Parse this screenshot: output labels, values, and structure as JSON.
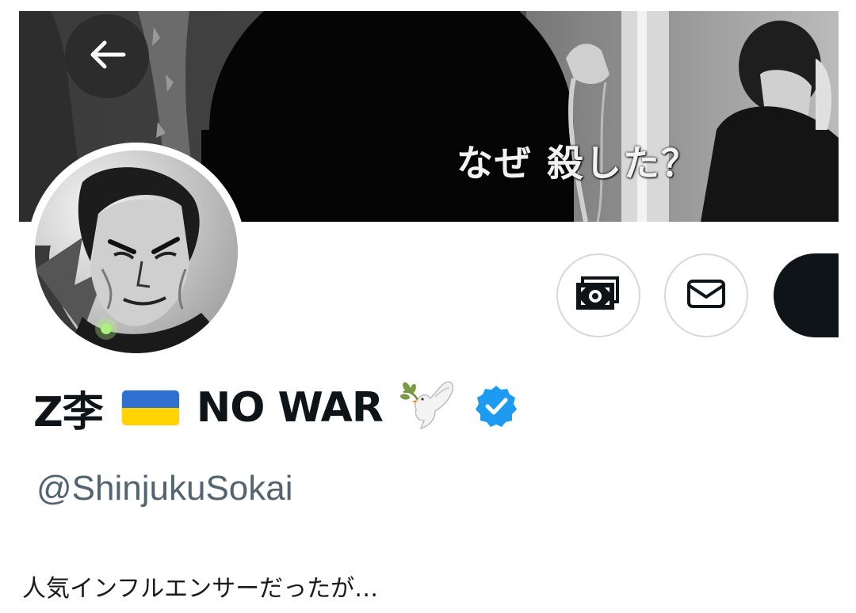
{
  "banner": {
    "caption": "なぜ 殺した？"
  },
  "header": {
    "back_icon": "arrow-left-icon"
  },
  "profile": {
    "display_name_prefix": "Z李",
    "flag": {
      "name": "ukraine-flag",
      "top_color": "#2f6fd0",
      "bottom_color": "#ffd400"
    },
    "display_name_suffix": "NO WAR",
    "dove_icon": "dove-with-olive-branch-icon",
    "verified_icon": "verified-badge-icon",
    "verified_color": "#1d9bf0",
    "handle": "@ShinjukuSokai"
  },
  "actions": {
    "tips_icon": "money-tips-icon",
    "message_icon": "envelope-icon"
  },
  "article": {
    "caption": "人気インフルエンサーだったが…"
  }
}
